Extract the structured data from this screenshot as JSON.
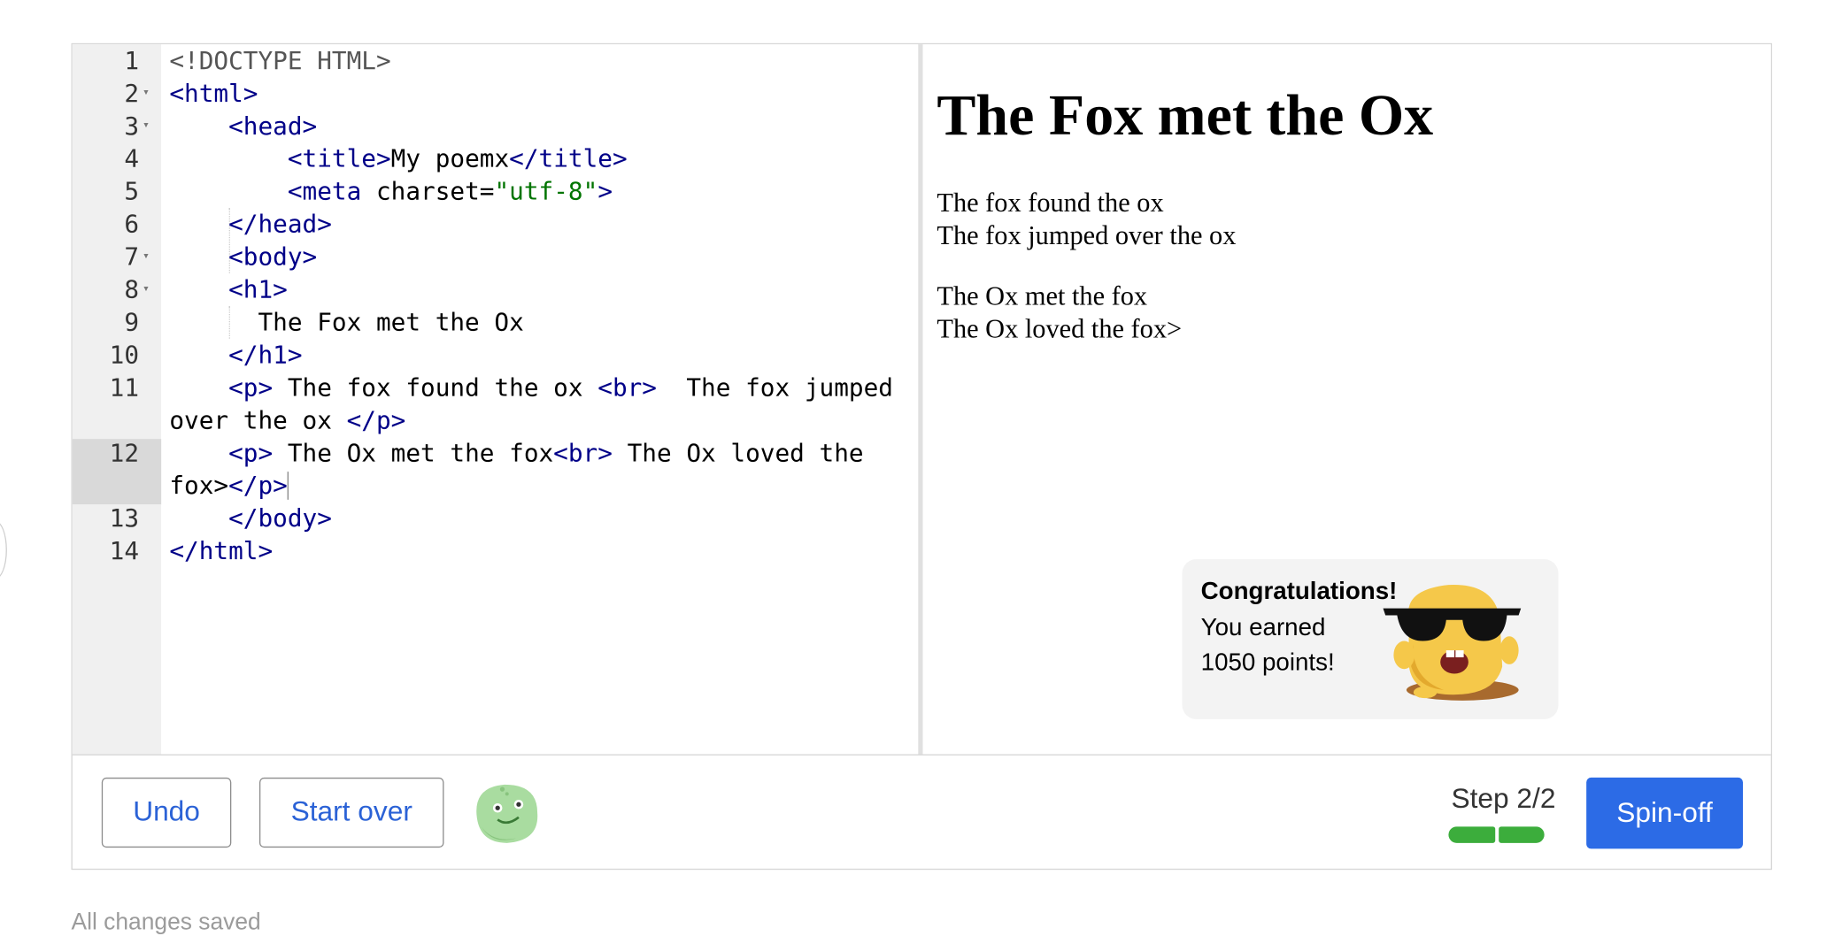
{
  "editor": {
    "lines": [
      {
        "n": "1",
        "fold": "",
        "html": "<span class=\"kw\">&lt;!DOCTYPE HTML&gt;</span>"
      },
      {
        "n": "2",
        "fold": "▾",
        "html": "<span class=\"tag\">&lt;html&gt;</span>"
      },
      {
        "n": "3",
        "fold": "▾",
        "html": "    <span class=\"tag\">&lt;head&gt;</span>"
      },
      {
        "n": "4",
        "fold": "",
        "html": "        <span class=\"tag\">&lt;title&gt;</span>My poemx<span class=\"tag\">&lt;/title&gt;</span>"
      },
      {
        "n": "5",
        "fold": "",
        "html": "        <span class=\"tag\">&lt;meta</span> <span class=\"attr\">charset</span>=<span class=\"str\">\"utf-8\"</span><span class=\"tag\">&gt;</span>"
      },
      {
        "n": "6",
        "fold": "",
        "html": "    <span class=\"tag\">&lt;/head&gt;</span>"
      },
      {
        "n": "7",
        "fold": "▾",
        "html": "    <span class=\"tag\">&lt;body&gt;</span>"
      },
      {
        "n": "8",
        "fold": "▾",
        "html": "    <span class=\"tag\">&lt;h1&gt;</span>"
      },
      {
        "n": "9",
        "fold": "",
        "html": "      The Fox met the Ox"
      },
      {
        "n": "10",
        "fold": "",
        "html": "    <span class=\"tag\">&lt;/h1&gt;</span>"
      },
      {
        "n": "11",
        "fold": "",
        "html": "    <span class=\"tag\">&lt;p&gt;</span> The fox found the ox <span class=\"tag\">&lt;br&gt;</span>  The fox jumped"
      },
      {
        "n": "",
        "fold": "",
        "html": "over the ox <span class=\"tag\">&lt;/p&gt;</span>"
      },
      {
        "n": "12",
        "fold": "",
        "html": "    <span class=\"tag\">&lt;p&gt;</span> The Ox met the fox<span class=\"tag\">&lt;br&gt;</span> The Ox loved the"
      },
      {
        "n": "",
        "fold": "",
        "html": "fox&gt;<span class=\"tag\">&lt;/p&gt;</span><span class=\"caret\"></span>"
      },
      {
        "n": "13",
        "fold": "",
        "html": "    <span class=\"tag\">&lt;/body&gt;</span>"
      },
      {
        "n": "14",
        "fold": "",
        "html": "<span class=\"tag\">&lt;/html&gt;</span>"
      }
    ]
  },
  "preview": {
    "heading": "The Fox met the Ox",
    "p1_line1": "The fox found the ox",
    "p1_line2": "The fox jumped over the ox",
    "p2_line1": "The Ox met the fox",
    "p2_line2": "The Ox loved the fox>"
  },
  "toast": {
    "title": "Congratulations!",
    "line1": "You earned",
    "line2": "1050 points!"
  },
  "toolbar": {
    "undo_label": "Undo",
    "start_over_label": "Start over",
    "step_label": "Step 2/2",
    "spin_off_label": "Spin-off",
    "progress_completed": 2,
    "progress_total": 2
  },
  "status": {
    "saved_text": "All changes saved"
  },
  "colors": {
    "accent": "#2c6be6",
    "progress": "#3cad3c",
    "tag": "#000088",
    "string": "#007400"
  },
  "icons": {
    "mascot": "sunglasses-monster-icon",
    "helper": "green-blob-icon"
  }
}
